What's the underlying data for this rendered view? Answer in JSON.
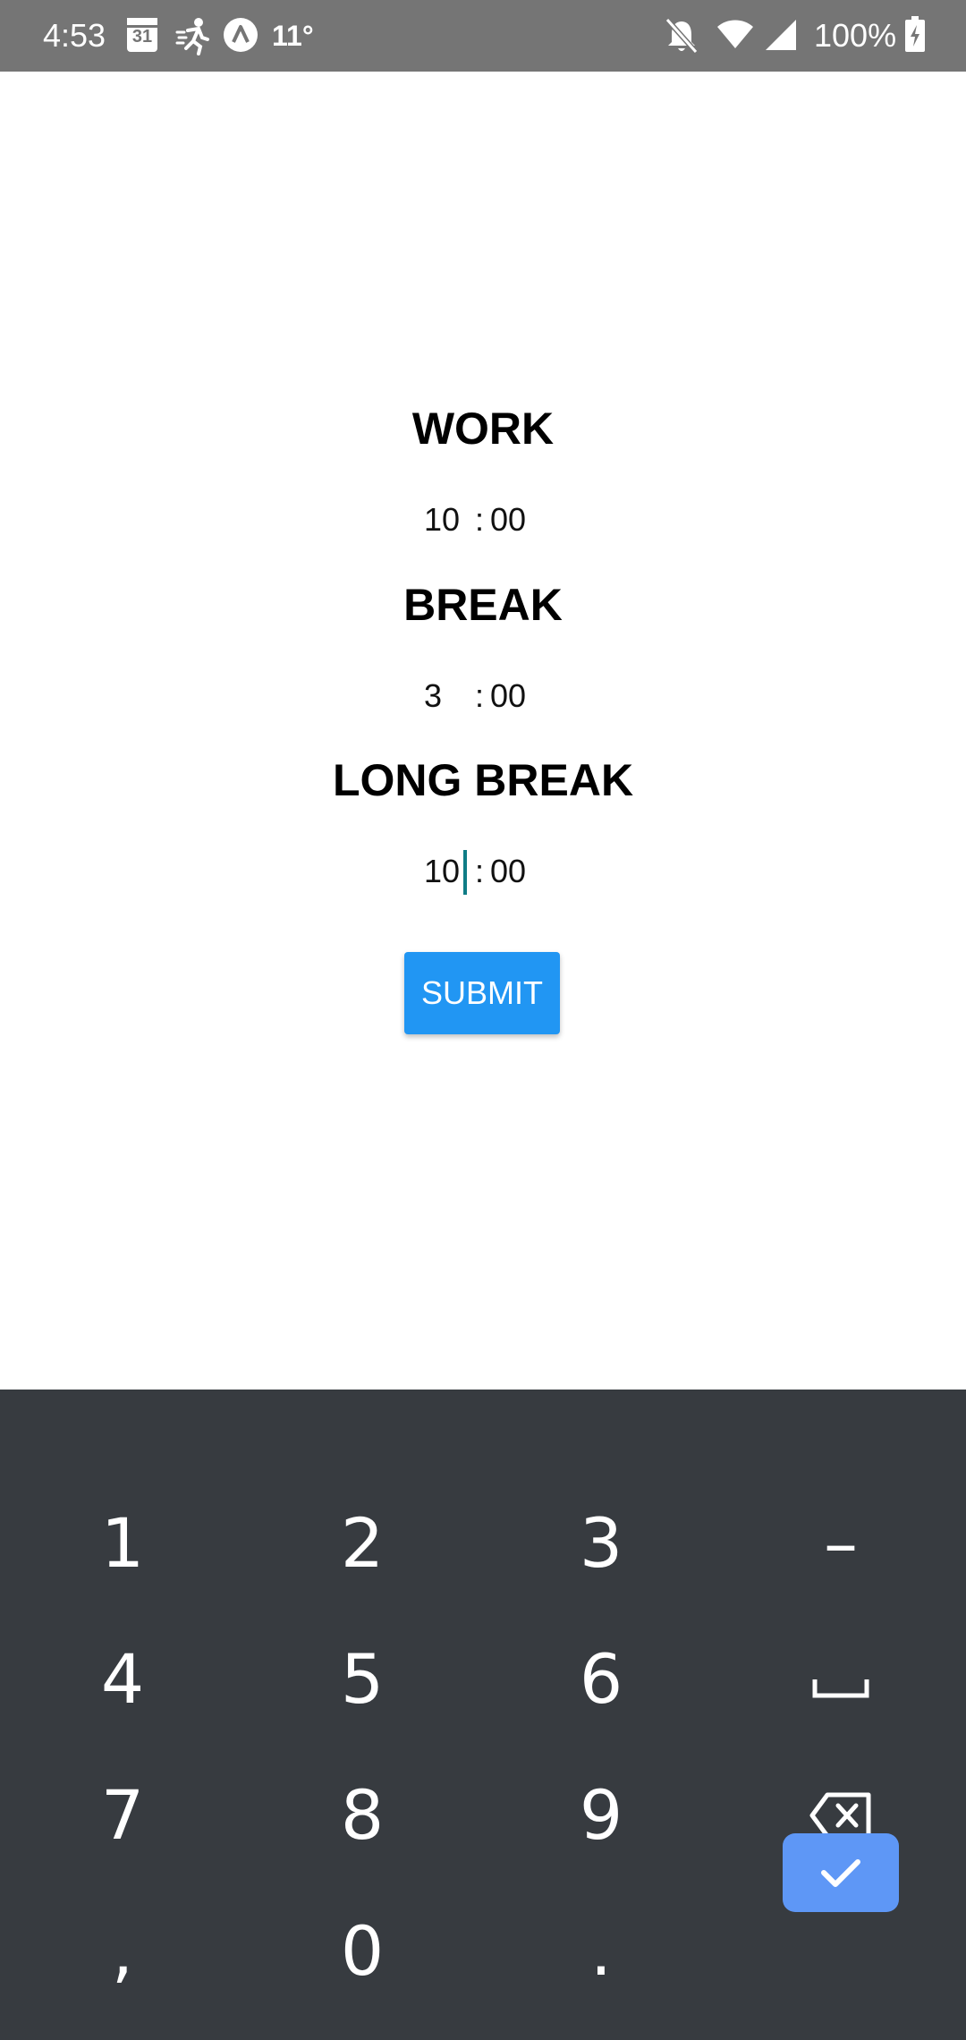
{
  "status_bar": {
    "time": "4:53",
    "calendar_day": "31",
    "temperature": "11°",
    "battery": "100%"
  },
  "form": {
    "work": {
      "label": "WORK",
      "minutes": "10",
      "separator": ":",
      "seconds": "00"
    },
    "break": {
      "label": "BREAK",
      "minutes": "3",
      "separator": ":",
      "seconds": "00"
    },
    "long_break": {
      "label": "LONG BREAK",
      "minutes": "10",
      "separator": ":",
      "seconds": "00"
    },
    "submit_label": "SUBMIT"
  },
  "keyboard": {
    "keys": [
      "1",
      "2",
      "3",
      "–",
      "4",
      "5",
      "6",
      "7",
      "8",
      "9",
      ",",
      "0",
      "."
    ]
  },
  "colors": {
    "status_bar": "#757575",
    "submit_button": "#2196f3",
    "keyboard_bg": "#373b40",
    "enter_key": "#5e97f6",
    "caret": "#0e7c86"
  }
}
